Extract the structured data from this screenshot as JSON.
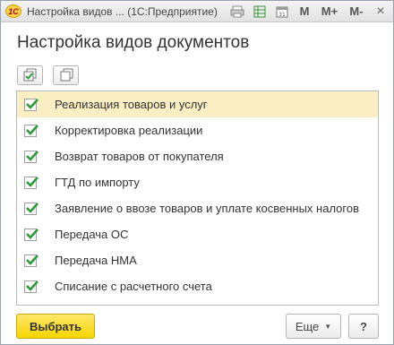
{
  "window": {
    "title": "Настройка видов ... (1С:Предприятие)",
    "logo_text": "1С",
    "m_label": "M",
    "m_plus_label": "M+",
    "m_minus_label": "M-",
    "close_glyph": "×"
  },
  "heading": "Настройка видов документов",
  "items": [
    {
      "label": "Реализация товаров и услуг",
      "checked": true
    },
    {
      "label": "Корректировка реализации",
      "checked": true
    },
    {
      "label": "Возврат товаров от покупателя",
      "checked": true
    },
    {
      "label": "ГТД по импорту",
      "checked": true
    },
    {
      "label": "Заявление о ввозе товаров и уплате косвенных налогов",
      "checked": true
    },
    {
      "label": "Передача ОС",
      "checked": true
    },
    {
      "label": "Передача НМА",
      "checked": true
    },
    {
      "label": "Списание с расчетного счета",
      "checked": true
    }
  ],
  "footer": {
    "select_label": "Выбрать",
    "more_label": "Еще",
    "help_label": "?"
  },
  "colors": {
    "accent": "#f5d500",
    "check": "#2f9a3a",
    "selected_row": "#f9efc2"
  }
}
